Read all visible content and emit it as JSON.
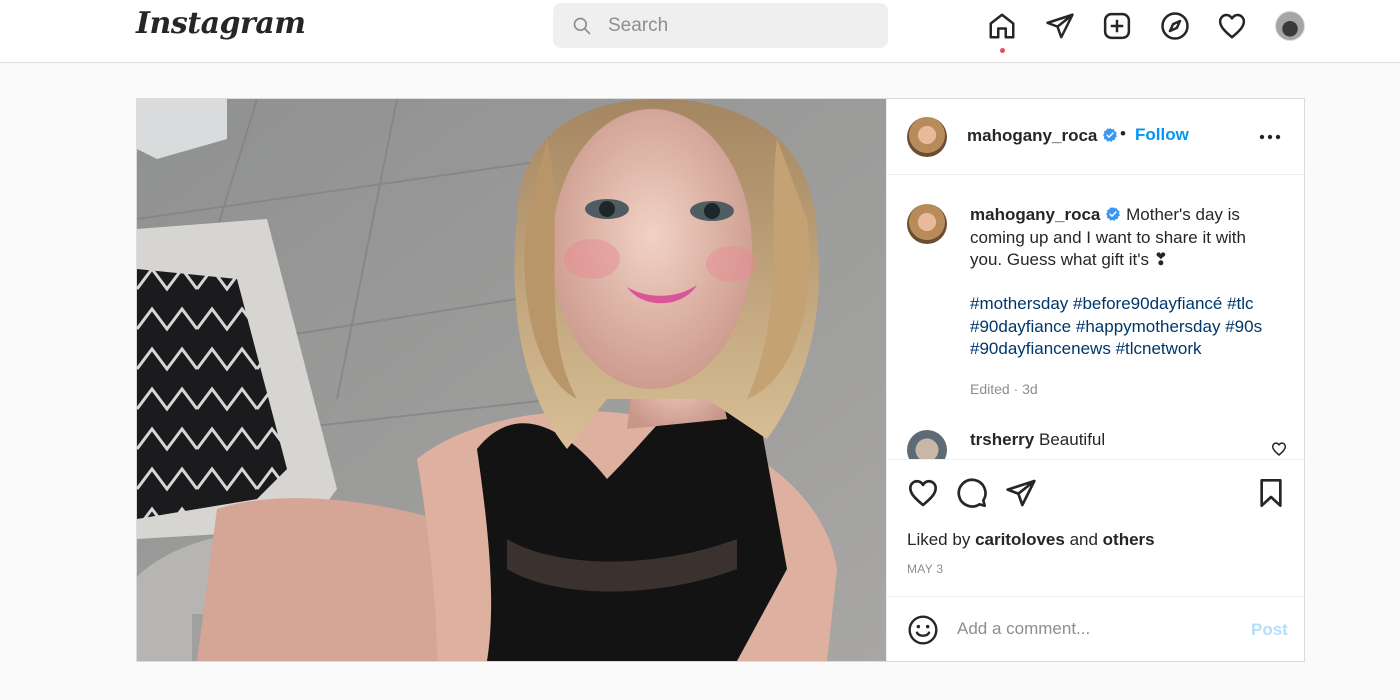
{
  "topbar": {
    "logo": "Instagram",
    "search_placeholder": "Search",
    "icons": [
      "home-icon",
      "direct-icon",
      "new-post-icon",
      "explore-icon",
      "activity-icon",
      "profile-avatar"
    ]
  },
  "post": {
    "username": "mahogany_roca",
    "verified": true,
    "separator": "•",
    "follow_label": "Follow",
    "more_label": "More options",
    "caption": {
      "username": "mahogany_roca",
      "text": "Mother's day is coming up and I want to share it with you. Guess what gift it's ❣",
      "hashtags": [
        "#mothersday",
        "#before90dayfiancé",
        "#tlc",
        "#90dayfiance",
        "#happymothersday",
        "#90s",
        "#90dayfiancenews",
        "#tlcnetwork"
      ],
      "edited": "Edited · 3d"
    },
    "comments": [
      {
        "username": "trsherry",
        "text": "Beautiful"
      }
    ],
    "liked_by": {
      "prefix": "Liked by",
      "user": "caritoloves",
      "conj": "and",
      "others": "others"
    },
    "date": "MAY 3",
    "comment_placeholder": "Add a comment...",
    "post_label": "Post"
  },
  "colors": {
    "accent": "#0095f6",
    "hashtag": "#00376b",
    "muted": "#8e8e8e",
    "notification_dot": "#ed4956",
    "post_disabled": "#b2dffc"
  }
}
